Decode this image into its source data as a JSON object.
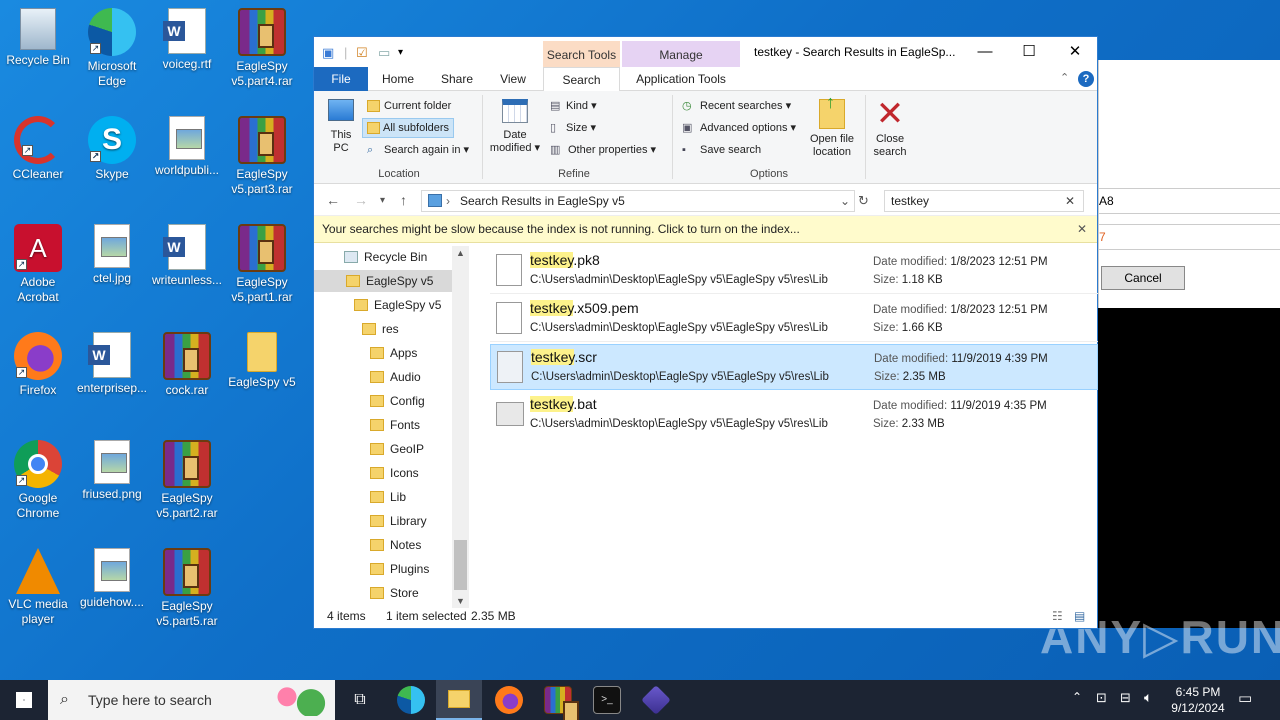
{
  "desktop": {
    "icons": [
      {
        "label": "Recycle Bin"
      },
      {
        "label": "Microsoft Edge"
      },
      {
        "label": "voiceg.rtf"
      },
      {
        "label": "EagleSpy v5.part4.rar"
      },
      {
        "label": "CCleaner"
      },
      {
        "label": "Skype"
      },
      {
        "label": "worldpubli..."
      },
      {
        "label": "EagleSpy v5.part3.rar"
      },
      {
        "label": "Adobe Acrobat"
      },
      {
        "label": "ctel.jpg"
      },
      {
        "label": "writeunless..."
      },
      {
        "label": "EagleSpy v5.part1.rar"
      },
      {
        "label": "Firefox"
      },
      {
        "label": "enterprisep..."
      },
      {
        "label": "cock.rar"
      },
      {
        "label": "EagleSpy v5"
      },
      {
        "label": "Google Chrome"
      },
      {
        "label": "friused.png"
      },
      {
        "label": "EagleSpy v5.part2.rar"
      },
      {
        "label": "VLC media player"
      },
      {
        "label": "guidehow...."
      },
      {
        "label": "EagleSpy v5.part5.rar"
      }
    ]
  },
  "explorer": {
    "title": "testkey - Search Results in EagleSp...",
    "context_tabs": {
      "search_tools": "Search Tools",
      "manage": "Manage"
    },
    "tabs": {
      "file": "File",
      "home": "Home",
      "share": "Share",
      "view": "View",
      "search": "Search",
      "app_tools": "Application Tools"
    },
    "ribbon": {
      "this_pc": "This PC",
      "current_folder": "Current folder",
      "all_subfolders": "All subfolders",
      "search_again_in": "Search again in",
      "location_label": "Location",
      "date_modified": "Date modified",
      "kind": "Kind",
      "size": "Size",
      "other_properties": "Other properties",
      "refine_label": "Refine",
      "recent_searches": "Recent searches",
      "advanced_options": "Advanced options",
      "save_search": "Save search",
      "open_file_location": "Open file location",
      "options_label": "Options",
      "close_search": "Close search"
    },
    "address": "Search Results in EagleSpy v5",
    "search_query": "testkey",
    "infobar": "Your searches might be slow because the index is not running.  Click to turn on the index...",
    "nav": [
      "Recycle Bin",
      "EagleSpy v5",
      "EagleSpy v5",
      "res",
      "Apps",
      "Audio",
      "Config",
      "Fonts",
      "GeoIP",
      "Icons",
      "Lib",
      "Library",
      "Notes",
      "Plugins",
      "Store"
    ],
    "files": [
      {
        "hl": "testkey",
        "rest": ".pk8",
        "path": "C:\\Users\\admin\\Desktop\\EagleSpy v5\\EagleSpy v5\\res\\Lib",
        "date_label": "Date modified:",
        "date": "1/8/2023 12:51 PM",
        "size_label": "Size:",
        "size": "1.18 KB"
      },
      {
        "hl": "testkey",
        "rest": ".x509.pem",
        "path": "C:\\Users\\admin\\Desktop\\EagleSpy v5\\EagleSpy v5\\res\\Lib",
        "date_label": "Date modified:",
        "date": "1/8/2023 12:51 PM",
        "size_label": "Size:",
        "size": "1.66 KB"
      },
      {
        "hl": "testkey",
        "rest": ".scr",
        "path": "C:\\Users\\admin\\Desktop\\EagleSpy v5\\EagleSpy v5\\res\\Lib",
        "date_label": "Date modified:",
        "date": "11/9/2019 4:39 PM",
        "size_label": "Size:",
        "size": "2.35 MB"
      },
      {
        "hl": "testkey",
        "rest": ".bat",
        "path": "C:\\Users\\admin\\Desktop\\EagleSpy v5\\EagleSpy v5\\res\\Lib",
        "date_label": "Date modified:",
        "date": "11/9/2019 4:35 PM",
        "size_label": "Size:",
        "size": "2.33 MB"
      }
    ],
    "status": {
      "count": "4 items",
      "selected": "1 item selected",
      "size": "2.35 MB"
    }
  },
  "bgwin": {
    "text1": "A8",
    "text2": "7",
    "cancel": "Cancel"
  },
  "watermark": "ANY▷RUN",
  "taskbar": {
    "search_placeholder": "Type here to search",
    "time": "6:45 PM",
    "date": "9/12/2024"
  },
  "colors": {
    "desktop": "#0f6fc8",
    "selection": "#cce8ff",
    "highlight": "#fdf28b",
    "taskbar": "#1c2433"
  }
}
